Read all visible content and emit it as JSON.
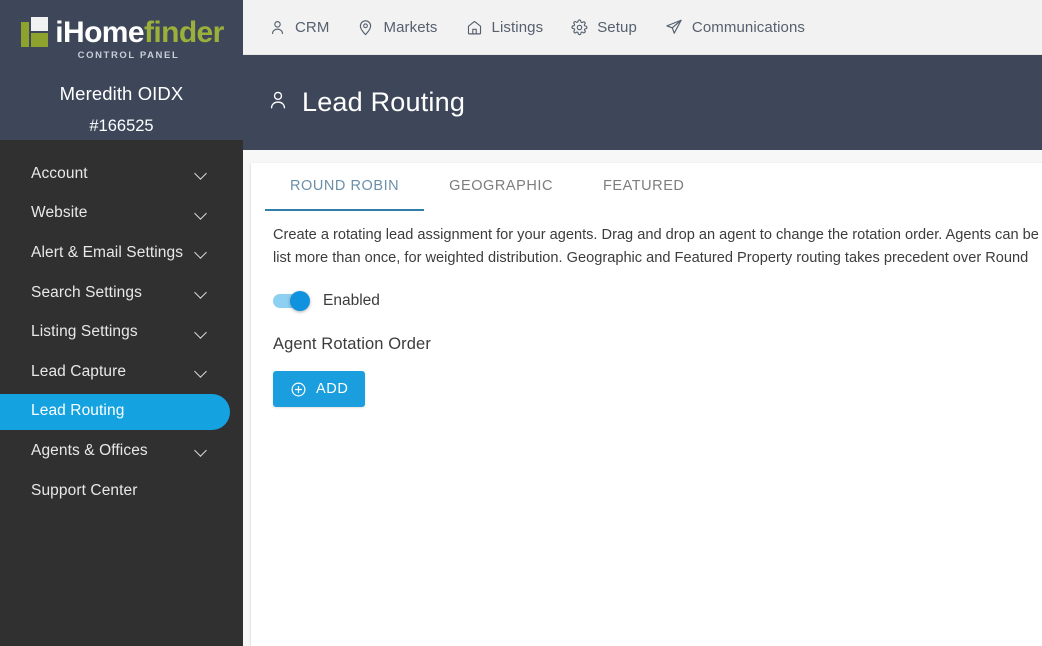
{
  "sidebar": {
    "logo": {
      "word_white": "iHome",
      "word_green": "finder",
      "subtitle": "CONTROL PANEL",
      "mark_icon": "house-bars-logo-icon"
    },
    "account_name": "Meredith OIDX",
    "account_id": "#166525",
    "items": [
      {
        "label": "Account",
        "expandable": true,
        "active": false
      },
      {
        "label": "Website",
        "expandable": true,
        "active": false
      },
      {
        "label": "Alert & Email Settings",
        "expandable": true,
        "active": false
      },
      {
        "label": "Search Settings",
        "expandable": true,
        "active": false
      },
      {
        "label": "Listing Settings",
        "expandable": true,
        "active": false
      },
      {
        "label": "Lead Capture",
        "expandable": true,
        "active": false
      },
      {
        "label": "Lead Routing",
        "expandable": false,
        "active": true
      },
      {
        "label": "Agents & Offices",
        "expandable": true,
        "active": false
      },
      {
        "label": "Support Center",
        "expandable": false,
        "active": false
      }
    ],
    "colors": {
      "top_bg": "#3d4759",
      "nav_bg": "#303030",
      "active_pill": "#14a3e0"
    }
  },
  "topnav": {
    "items": [
      {
        "label": "CRM",
        "icon": "person-icon"
      },
      {
        "label": "Markets",
        "icon": "map-pin-icon"
      },
      {
        "label": "Listings",
        "icon": "house-icon"
      },
      {
        "label": "Setup",
        "icon": "gear-icon"
      },
      {
        "label": "Communications",
        "icon": "paper-plane-icon"
      }
    ]
  },
  "page_header": {
    "title": "Lead Routing",
    "icon": "person-icon",
    "bg_color": "#3d4759"
  },
  "main": {
    "tabs": [
      {
        "label": "ROUND ROBIN",
        "active": true
      },
      {
        "label": "GEOGRAPHIC",
        "active": false
      },
      {
        "label": "FEATURED",
        "active": false
      }
    ],
    "description": "Create a rotating lead assignment for your agents. Drag and drop an agent to change the rotation order. Agents can be\nlist more than once, for weighted distribution. Geographic and Featured Property routing takes precedent over Round",
    "toggle": {
      "label": "Enabled",
      "state": "on",
      "on_color": "#1192df"
    },
    "section_title": "Agent Rotation Order",
    "add_button": {
      "label": "ADD",
      "icon": "plus-circle-icon",
      "color": "#1a9ede"
    }
  }
}
